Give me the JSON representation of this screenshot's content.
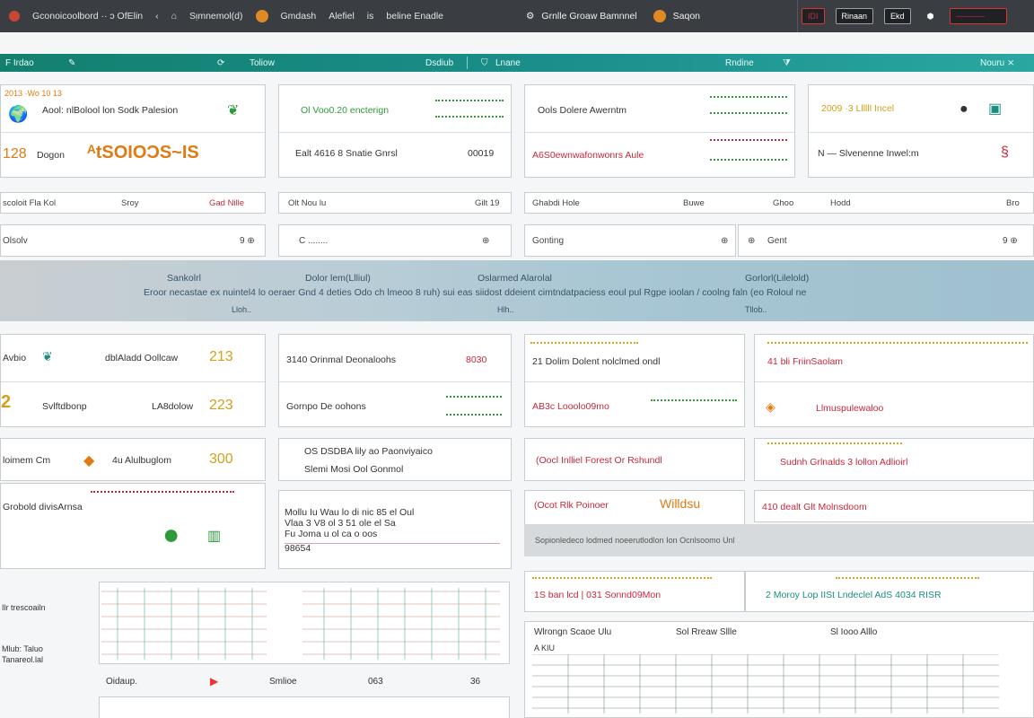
{
  "topbar": {
    "breadcrumb": [
      "Gconoicoolbord ·· ɔ OfElin",
      "Sᴉmnemol(d)",
      "Gmdash",
      "Alefiel",
      "is",
      "beline Enadle"
    ],
    "center_title": "Grnlle Groaw Bamnnel",
    "center_user": "Saqon",
    "right_buttons": [
      "IDI",
      "Rinaan",
      "Ekd",
      "⬢",
      "─────"
    ]
  },
  "tealbar": {
    "items": [
      "F Irdao",
      "Toliow",
      "Dsdiub",
      "Lnane",
      "Rndine",
      "Nouru ⨯"
    ]
  },
  "kpi_row1": [
    {
      "title": "2013 ·Wo 10 13",
      "line1": "Aool: nlBolool lon Sodk Palesion",
      "line2_value": "128",
      "line2_label": "Dogon",
      "big": "ᴬtSOIOƆS~IS"
    },
    {
      "line1": "Ol Voo0.20 encterign",
      "line2": "Ealt 4616 8 Snatie Gnrsl",
      "line2_value": "00019"
    },
    {
      "line1": "Ools Dolere Awerntm",
      "line2": "A6S0ewnwafonwonrs Aule"
    },
    {
      "title": "2009 ·3 Llllll Incel",
      "line2": "N — Slvenenne Inwel:m"
    }
  ],
  "rowbars": [
    {
      "a": "scoloit Fla Kol",
      "b": "Sroy",
      "c": "Gad Nille"
    },
    {
      "a": "Olt Nou lu",
      "b": "Gilt 19"
    },
    {
      "a": "Ghabdi Hole",
      "b": "Buwe",
      "c": "Ghoo"
    },
    {
      "a": "Hodd",
      "b": "Bro"
    }
  ],
  "filters": [
    {
      "label": "Olsolv",
      "icon": "9 ⊕"
    },
    {
      "label": "C ........",
      "icon": "⊕"
    },
    {
      "label": "Gonting",
      "icon": "⊕"
    },
    {
      "label": "Gent",
      "icon": "9 ⊕"
    }
  ],
  "banner": {
    "titles": [
      "Sankolrl",
      "Dolor lem(Llliul)",
      "Oslarmed Alarolal",
      "Gorlorl(Lilelold)"
    ],
    "sentence": "Eroor necastae ex nuintel4 lo oeraer Gnd 4 deties Odo ch lmeoo 8 ruh) sui eas siidost ddeient cimtndatpaciess eoul pul Rgpe ioolan / coolng faln (eo Roloul ne",
    "subs": [
      "Lloh..",
      "Hlh..",
      "Tllob.."
    ]
  },
  "kpi_row2": [
    {
      "a": "Avbio",
      "b": "dblAladd Oollcaw",
      "v": "213",
      "c": "2",
      "d": "Svlftdbonp",
      "e": "LA8dolow",
      "v2": "223"
    },
    {
      "a": "3140 Orinmal Deonaloohs",
      "v": "8030",
      "b": "Gornpo De oohons"
    },
    {
      "a": "21 Dolim Dolent nolclmed ondl",
      "b": "AB3c Looolo09mo"
    },
    {
      "a": "41 bli FriinSaolam",
      "b": "Llmuspulewaloo"
    }
  ],
  "kpi_row3": [
    {
      "a": "loimem Cm",
      "b": "4u Alulbuglom",
      "v": "300"
    },
    {
      "a": "OS DSDBA lily ao Paonviyaico",
      "b": "Slemi Mosi Ool Gonmol"
    },
    {
      "a": "(Oocl Inlliel Forest Or Rshundl"
    },
    {
      "a": "Sudnh Grlnalds 3 lollon Adlioirl"
    }
  ],
  "kpi_row4": [
    {
      "title": "Grobold divisArnsa"
    },
    {
      "lines": [
        "Mollu Iu Wau lo di nic 85 el Oul",
        "Vlaa 3 V8 ol 3 51 ole el Sa",
        "Fu Joma u ol ca o oos"
      ],
      "v": "98654"
    },
    {
      "a": "(Ocot Rlk Poinoer",
      "b": "Willdsu",
      "band": "Sopionledeco lodmed noeerutlodlon Ion Ocnlsoomo Unl"
    },
    {
      "a": "410 dealt Glt Molnsdoom"
    }
  ],
  "row5": [
    {
      "a": "1S ban lcd | 031 Sonnd09Mon"
    },
    {
      "a": "2 Moroy Lop IISt Lndeclel AdS 4034 RISR"
    }
  ],
  "chart_section": {
    "left_labels": [
      "Ilr trescoailn",
      "Mlub: Taluo",
      "Tanareol.lal"
    ],
    "bottom_labels": [
      "Oidaup.",
      "Smlioe",
      "063",
      "36"
    ]
  },
  "table_section": {
    "headers": [
      "Wlrongn   Scaoe Ulu",
      "Sol Rreaw   Sllle",
      "Sl Iooo Alllo"
    ],
    "subheader": "A KIU"
  },
  "colors": {
    "accent": "#1b8f8c",
    "orange": "#e07a12",
    "green": "#2e9a3a",
    "red": "#c8283c"
  }
}
